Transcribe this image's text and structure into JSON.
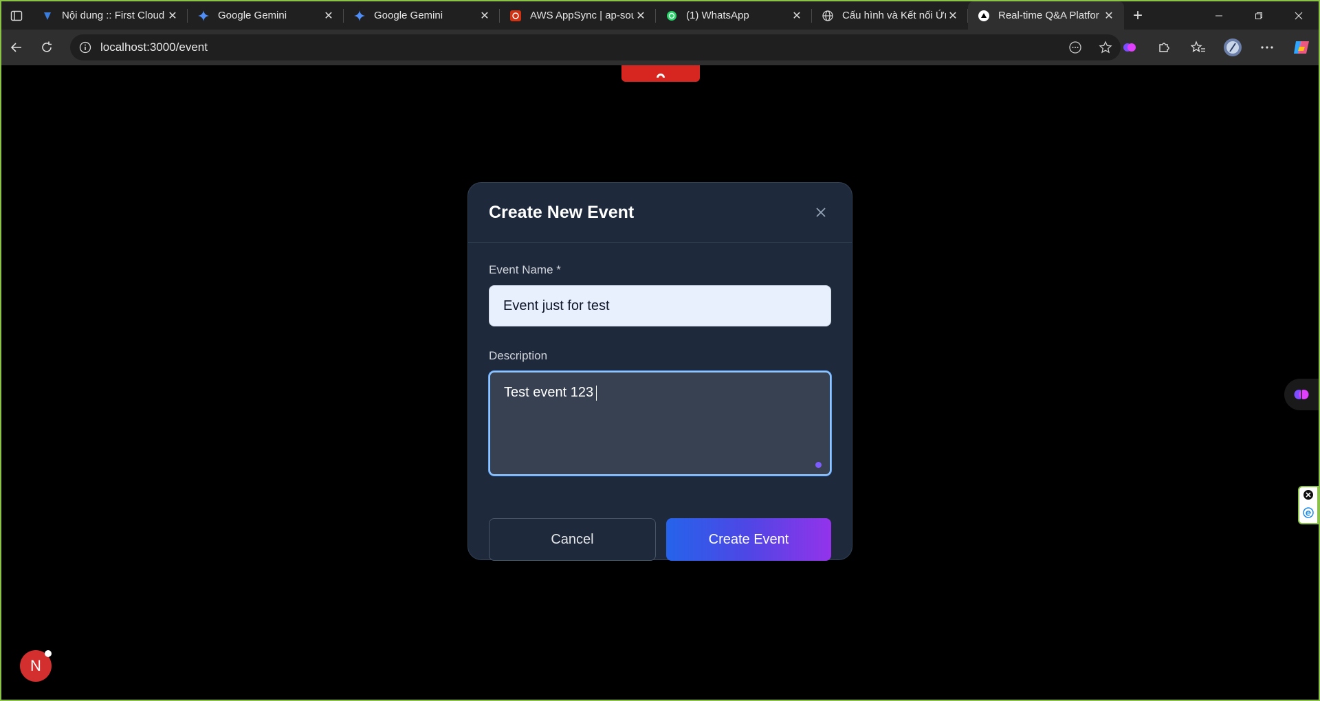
{
  "browser": {
    "tabs": [
      {
        "title": "Nội dung :: First Cloud",
        "icon": "firstcloud-icon",
        "active": false
      },
      {
        "title": "Google Gemini",
        "icon": "gemini-icon",
        "active": false
      },
      {
        "title": "Google Gemini",
        "icon": "gemini-icon",
        "active": false
      },
      {
        "title": "AWS AppSync | ap-sou",
        "icon": "aws-appsync-icon",
        "active": false
      },
      {
        "title": "(1) WhatsApp",
        "icon": "whatsapp-icon",
        "active": false
      },
      {
        "title": "Cấu hình và Kết nối Ứn",
        "icon": "globe-icon",
        "active": false
      },
      {
        "title": "Real-time Q&A Platfor",
        "icon": "vercel-triangle-icon",
        "active": true
      }
    ],
    "url": "localhost:3000/event"
  },
  "modal": {
    "title": "Create New Event",
    "event_name_label": "Event Name *",
    "event_name_value": "Event just for test",
    "description_label": "Description",
    "description_value": "Test event 123",
    "cancel_label": "Cancel",
    "create_label": "Create Event"
  },
  "dev": {
    "badge_letter": "N"
  },
  "colors": {
    "modal_bg": "#1e293b",
    "accent_start": "#2563eb",
    "accent_end": "#9333ea",
    "page_bg": "#000000"
  }
}
